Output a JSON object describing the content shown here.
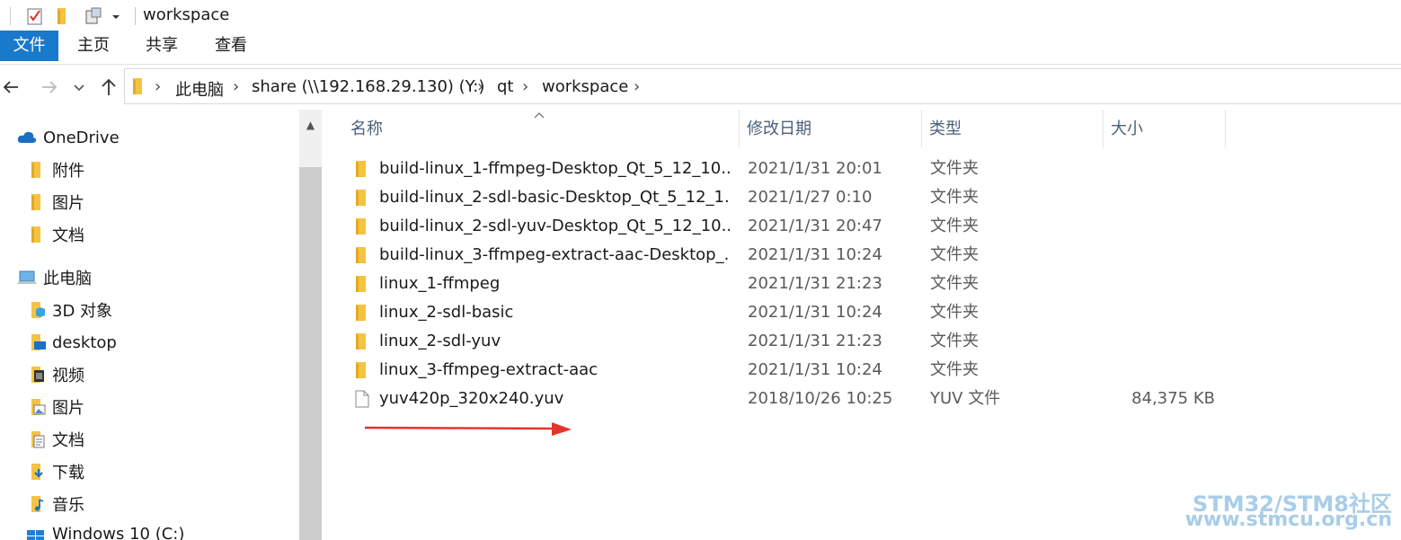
{
  "window": {
    "title": "workspace"
  },
  "ribbon": {
    "tabs": [
      "文件",
      "主页",
      "共享",
      "查看"
    ]
  },
  "address": {
    "crumbs": [
      "此电脑",
      "share (\\\\192.168.29.130) (Y:)",
      "qt",
      "workspace"
    ]
  },
  "sidebar": {
    "items": [
      {
        "label": "OneDrive",
        "icon": "cloud-icon"
      },
      {
        "label": "附件",
        "icon": "folder-icon"
      },
      {
        "label": "图片",
        "icon": "folder-icon"
      },
      {
        "label": "文档",
        "icon": "folder-icon"
      },
      {
        "label": "此电脑",
        "icon": "computer-icon"
      },
      {
        "label": "3D 对象",
        "icon": "3d-objects-icon"
      },
      {
        "label": "desktop",
        "icon": "desktop-icon"
      },
      {
        "label": "视频",
        "icon": "video-icon"
      },
      {
        "label": "图片",
        "icon": "pictures-icon"
      },
      {
        "label": "文档",
        "icon": "documents-icon"
      },
      {
        "label": "下载",
        "icon": "download-icon"
      },
      {
        "label": "音乐",
        "icon": "music-icon"
      },
      {
        "label": "Windows 10 (C:)",
        "icon": "drive-icon"
      }
    ]
  },
  "columns": {
    "name": "名称",
    "date": "修改日期",
    "type": "类型",
    "size": "大小"
  },
  "files": [
    {
      "name": "build-linux_1-ffmpeg-Desktop_Qt_5_12_10...",
      "date": "2021/1/31 20:01",
      "type": "文件夹",
      "size": "",
      "icon": "folder-icon"
    },
    {
      "name": "build-linux_2-sdl-basic-Desktop_Qt_5_12_1...",
      "date": "2021/1/27 0:10",
      "type": "文件夹",
      "size": "",
      "icon": "folder-icon"
    },
    {
      "name": "build-linux_2-sdl-yuv-Desktop_Qt_5_12_10...",
      "date": "2021/1/31 20:47",
      "type": "文件夹",
      "size": "",
      "icon": "folder-icon"
    },
    {
      "name": "build-linux_3-ffmpeg-extract-aac-Desktop_...",
      "date": "2021/1/31 10:24",
      "type": "文件夹",
      "size": "",
      "icon": "folder-icon"
    },
    {
      "name": "linux_1-ffmpeg",
      "date": "2021/1/31 21:23",
      "type": "文件夹",
      "size": "",
      "icon": "folder-icon"
    },
    {
      "name": "linux_2-sdl-basic",
      "date": "2021/1/31 10:24",
      "type": "文件夹",
      "size": "",
      "icon": "folder-icon"
    },
    {
      "name": "linux_2-sdl-yuv",
      "date": "2021/1/31 21:23",
      "type": "文件夹",
      "size": "",
      "icon": "folder-icon"
    },
    {
      "name": "linux_3-ffmpeg-extract-aac",
      "date": "2021/1/31 10:24",
      "type": "文件夹",
      "size": "",
      "icon": "folder-icon"
    },
    {
      "name": "yuv420p_320x240.yuv",
      "date": "2018/10/26 10:25",
      "type": "YUV 文件",
      "size": "84,375 KB",
      "icon": "file-icon"
    }
  ],
  "watermark": {
    "line1": "STM32/STM8社区",
    "line2": "www.stmcu.org.cn"
  },
  "colors": {
    "accent": "#1979ca",
    "folder": "#f5c342",
    "arrow": "#e8322d",
    "header_text": "#4c607a"
  }
}
